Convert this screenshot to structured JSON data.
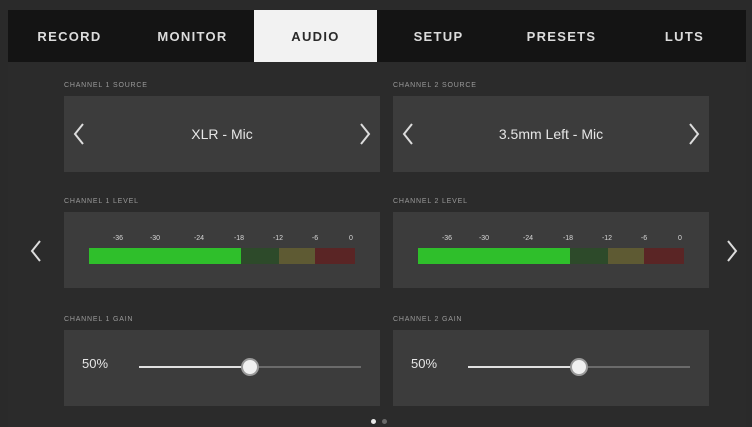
{
  "tabs": [
    {
      "label": "RECORD",
      "active": false
    },
    {
      "label": "MONITOR",
      "active": false
    },
    {
      "label": "AUDIO",
      "active": true
    },
    {
      "label": "SETUP",
      "active": false
    },
    {
      "label": "PRESETS",
      "active": false
    },
    {
      "label": "LUTS",
      "active": false
    }
  ],
  "channel1": {
    "source_label": "CHANNEL 1 SOURCE",
    "source_value": "XLR - Mic",
    "level_label": "CHANNEL 1 LEVEL",
    "gain_label": "CHANNEL 1 GAIN",
    "gain_value": "50%",
    "gain_fraction": 0.5
  },
  "channel2": {
    "source_label": "CHANNEL 2 SOURCE",
    "source_value": "3.5mm Left - Mic",
    "level_label": "CHANNEL 2 LEVEL",
    "gain_label": "CHANNEL 2 GAIN",
    "gain_value": "50%",
    "gain_fraction": 0.5
  },
  "meter_ticks": [
    "-36",
    "-30",
    "-24",
    "-18",
    "-12",
    "-6",
    "0"
  ],
  "colors": {
    "active_tab_bg": "#f2f2f2",
    "meter_green": "#2fbf2b",
    "meter_yellow": "#5e5a33",
    "meter_red": "#5a2525"
  },
  "pages": {
    "current": 1,
    "total": 2
  }
}
